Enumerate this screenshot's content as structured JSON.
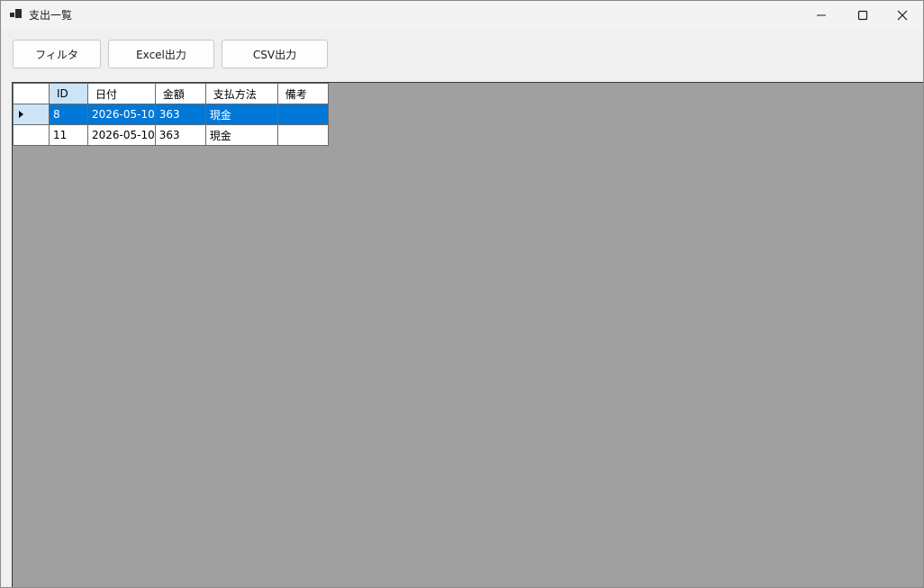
{
  "window": {
    "title": "支出一覧"
  },
  "toolbar": {
    "filter_label": "フィルタ",
    "excel_label": "Excel出力",
    "csv_label": "CSV出力"
  },
  "grid": {
    "columns": [
      "ID",
      "日付",
      "金額",
      "支払方法",
      "備考"
    ],
    "rows": [
      {
        "id": "8",
        "date": "2026-05-10",
        "amount": "363",
        "method": "現金",
        "note": ""
      },
      {
        "id": "11",
        "date": "2026-05-10",
        "amount": "363",
        "method": "現金",
        "note": ""
      }
    ],
    "selected_row_index": 0
  },
  "colors": {
    "selection": "#0078d7",
    "header_highlight": "#cce4f7",
    "grid_background": "#a0a0a0"
  },
  "icons": [
    "app-icon",
    "minimize-icon",
    "maximize-icon",
    "close-icon",
    "row-pointer-icon"
  ]
}
